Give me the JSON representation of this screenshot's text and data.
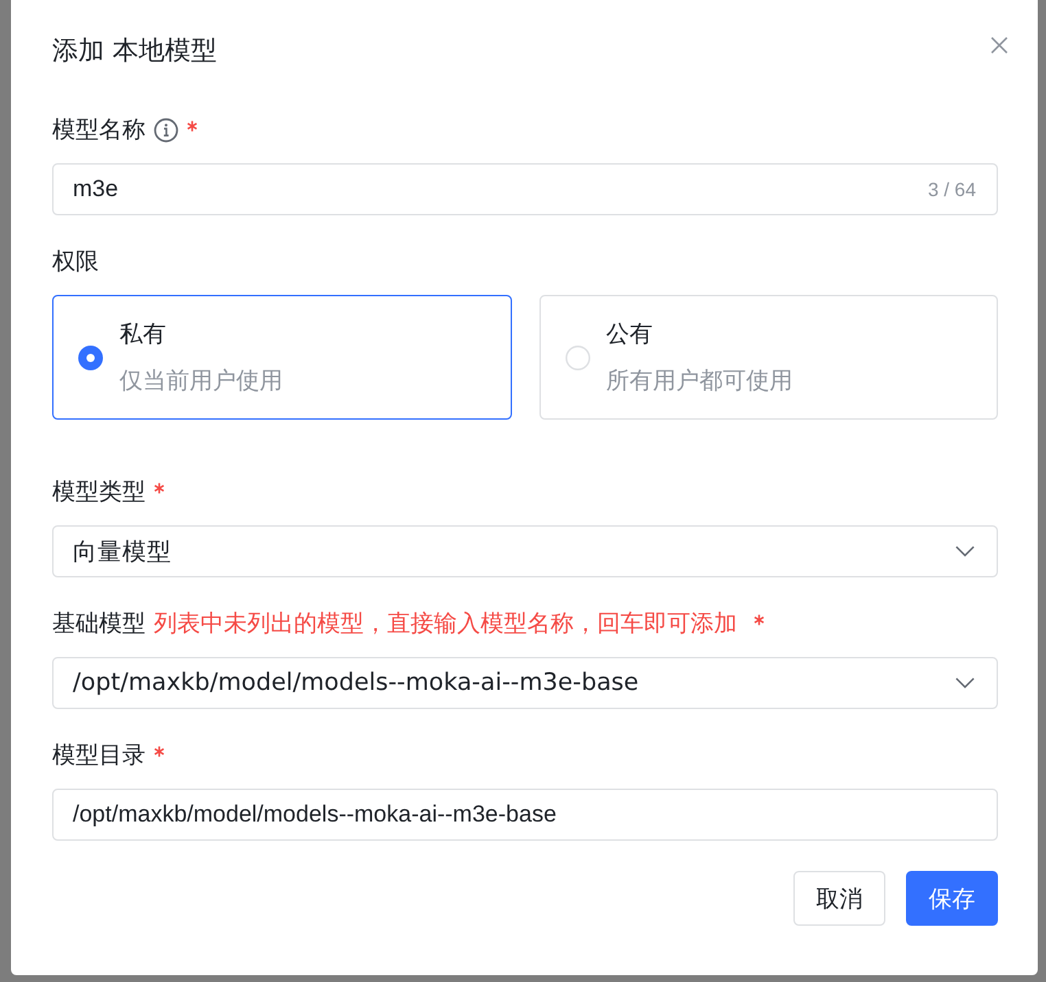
{
  "dialog": {
    "title": "添加 本地模型"
  },
  "fields": [
    {
      "kind": "text",
      "label": "模型名称",
      "info": true,
      "required": true,
      "value": "m3e",
      "counter": "3 / 64"
    },
    {
      "kind": "radio-cards",
      "label": "权限",
      "info": false,
      "required": false,
      "options": [
        {
          "title": "私有",
          "description": "仅当前用户使用",
          "selected": true
        },
        {
          "title": "公有",
          "description": "所有用户都可使用",
          "selected": false
        }
      ]
    },
    {
      "kind": "select",
      "label": "模型类型",
      "info": false,
      "required": true,
      "value": "向量模型"
    },
    {
      "kind": "select",
      "label": "基础模型",
      "info": false,
      "hint": "列表中未列出的模型，直接输入模型名称，回车即可添加",
      "required": true,
      "value": "/opt/maxkb/model/models--moka-ai--m3e-base"
    },
    {
      "kind": "text",
      "label": "模型目录",
      "info": false,
      "required": true,
      "value": "/opt/maxkb/model/models--moka-ai--m3e-base"
    }
  ],
  "buttons": [
    {
      "label": "取消",
      "kind": "default"
    },
    {
      "label": "保存",
      "kind": "primary"
    }
  ]
}
